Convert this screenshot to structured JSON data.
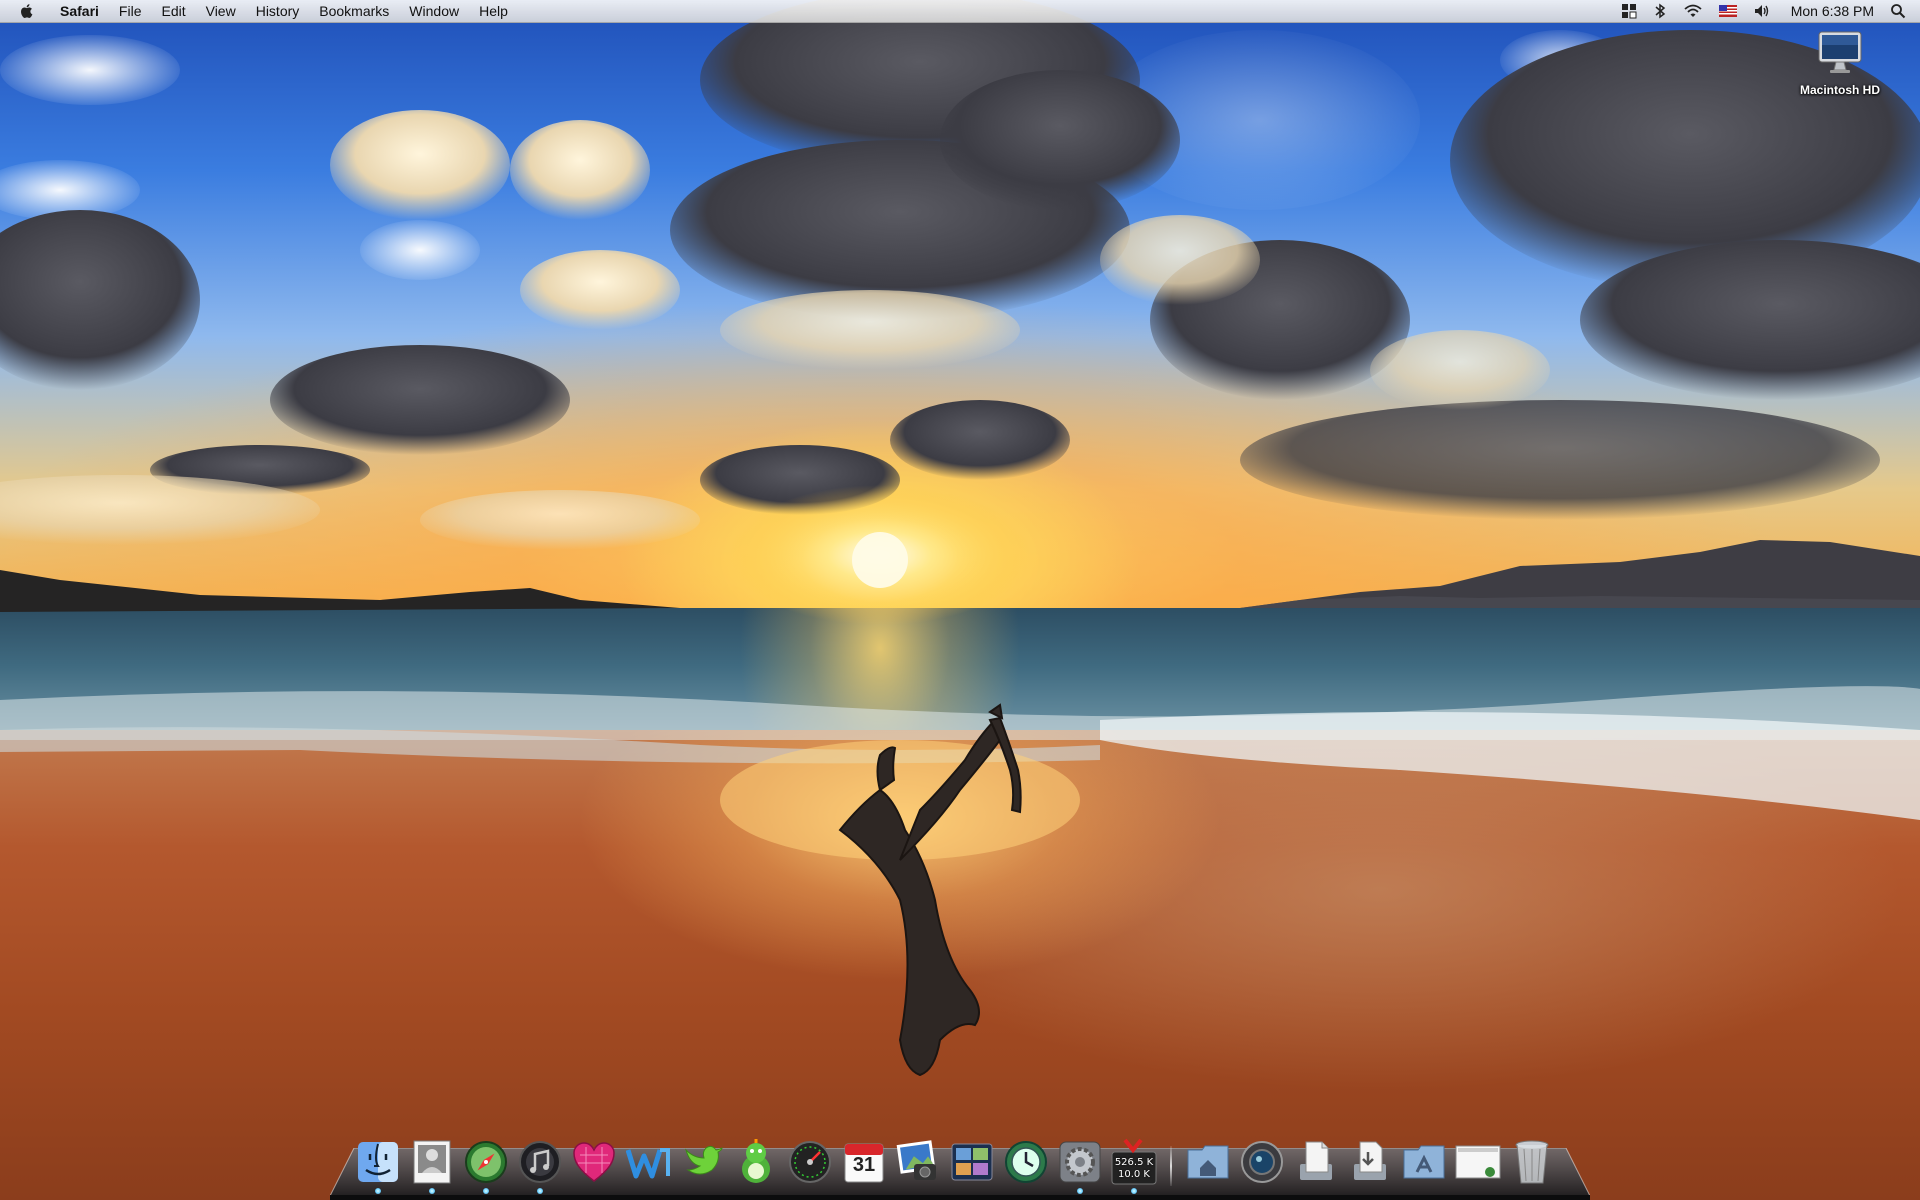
{
  "menubar": {
    "app_name": "Safari",
    "menus": [
      "File",
      "Edit",
      "View",
      "History",
      "Bookmarks",
      "Window",
      "Help"
    ],
    "clock": "Mon 6:38 PM",
    "status_icons": [
      "spaces-icon",
      "bluetooth-icon",
      "wifi-icon",
      "flag-icon",
      "volume-icon",
      "spotlight-icon"
    ]
  },
  "desktop": {
    "icons": [
      {
        "label": "Macintosh HD",
        "icon": "hard-drive-icon"
      }
    ]
  },
  "dock": {
    "apps": [
      {
        "name": "finder-icon",
        "running": true
      },
      {
        "name": "preview-icon",
        "running": true
      },
      {
        "name": "safari-icon",
        "running": true
      },
      {
        "name": "itunes-icon",
        "running": true
      },
      {
        "name": "heart-app-icon",
        "running": false
      },
      {
        "name": "word-processor-icon",
        "running": false
      },
      {
        "name": "twitter-bird-icon",
        "running": false
      },
      {
        "name": "adium-icon",
        "running": false
      },
      {
        "name": "dashboard-icon",
        "running": false
      },
      {
        "name": "ical-icon",
        "running": false
      },
      {
        "name": "iphoto-icon",
        "running": false
      },
      {
        "name": "spaces-app-icon",
        "running": false
      },
      {
        "name": "time-machine-icon",
        "running": false
      },
      {
        "name": "system-preferences-icon",
        "running": true
      },
      {
        "name": "network-meter-icon",
        "running": true
      }
    ],
    "calendar_day": "31",
    "calendar_month": "MAR",
    "meter_up": "526.5 K",
    "meter_down": "10.0 K",
    "stacks": [
      {
        "name": "home-folder-icon"
      },
      {
        "name": "camera-app-icon"
      },
      {
        "name": "documents-stack-icon"
      },
      {
        "name": "downloads-stack-icon"
      },
      {
        "name": "applications-folder-icon"
      },
      {
        "name": "screenshot-stack-icon"
      },
      {
        "name": "trash-icon"
      }
    ]
  },
  "colors": {
    "accent": "#3b7de0",
    "sun": "#ffe07a",
    "sand": "#b4582e"
  }
}
